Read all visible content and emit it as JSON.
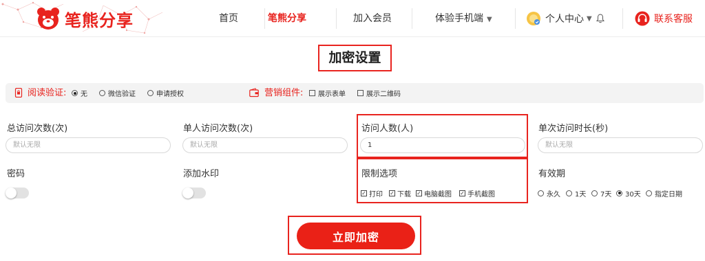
{
  "brand": {
    "name": "笔熊分享",
    "accent": "#e8231e"
  },
  "nav": {
    "items": [
      {
        "label": "首页"
      },
      {
        "label": "笔熊分享"
      },
      {
        "label": "加入会员"
      },
      {
        "label": "体验手机端"
      }
    ],
    "user": "个人中心",
    "service": "联系客服"
  },
  "page_title": "加密设置",
  "options": {
    "read_verify": {
      "label": "阅读验证:",
      "choices": [
        "无",
        "微信验证",
        "申请授权"
      ],
      "selected": "无"
    },
    "marketing": {
      "label": "营销组件:",
      "choices": [
        "展示表单",
        "展示二维码"
      ]
    }
  },
  "fields": {
    "total_visits": {
      "label": "总访问次数(次)",
      "placeholder": "默认无限",
      "value": ""
    },
    "single_visits": {
      "label": "单人访问次数(次)",
      "placeholder": "默认无限",
      "value": ""
    },
    "visitor_count": {
      "label": "访问人数(人)",
      "placeholder": "",
      "value": "1"
    },
    "single_duration": {
      "label": "单次访问时长(秒)",
      "placeholder": "默认无限",
      "value": ""
    },
    "password": {
      "label": "密码",
      "enabled": false
    },
    "watermark": {
      "label": "添加水印",
      "enabled": false
    },
    "restrictions": {
      "label": "限制选项",
      "items": [
        {
          "label": "打印",
          "checked": true
        },
        {
          "label": "下载",
          "checked": true
        },
        {
          "label": "电脑截图",
          "checked": true
        },
        {
          "label": "手机截图",
          "checked": true
        }
      ]
    },
    "expiry": {
      "label": "有效期",
      "choices": [
        "永久",
        "1天",
        "7天",
        "30天",
        "指定日期"
      ],
      "selected": "30天"
    }
  },
  "submit": "立即加密"
}
